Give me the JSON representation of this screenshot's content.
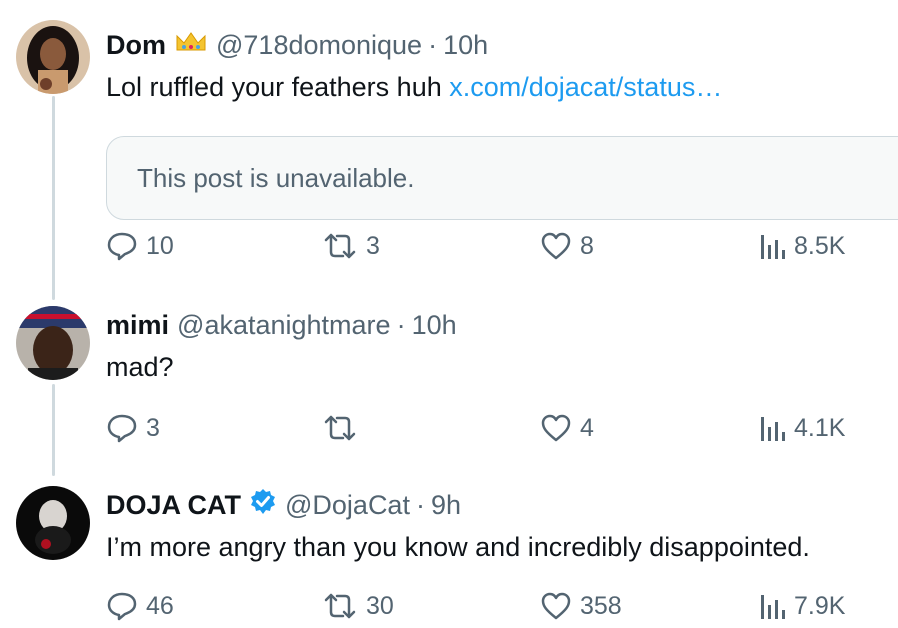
{
  "tweets": [
    {
      "name": "Dom",
      "badge_icon": "crown-icon",
      "handle": "@718domonique",
      "separator": "·",
      "time": "10h",
      "text": "Lol ruffled your feathers huh ",
      "link": "x.com/dojacat/status…",
      "quote_text": "This post is unavailable.",
      "actions": {
        "replies": "10",
        "reposts": "3",
        "likes": "8",
        "views": "8.5K"
      }
    },
    {
      "name": "mimi",
      "handle": "@akatanightmare",
      "separator": "·",
      "time": "10h",
      "text": "mad?",
      "actions": {
        "replies": "3",
        "reposts": "",
        "likes": "4",
        "views": "4.1K"
      }
    },
    {
      "name": "DOJA CAT",
      "badge_icon": "verified-badge-icon",
      "handle": "@DojaCat",
      "separator": "·",
      "time": "9h",
      "text": "I’m more angry than you know and incredibly disappointed.",
      "actions": {
        "replies": "46",
        "reposts": "30",
        "likes": "358",
        "views": "7.9K"
      }
    }
  ],
  "colors": {
    "text_primary": "#0f1419",
    "text_secondary": "#536471",
    "link": "#1d9bf0",
    "thread_line": "#cfd9de",
    "verified": "#1d9bf0"
  }
}
